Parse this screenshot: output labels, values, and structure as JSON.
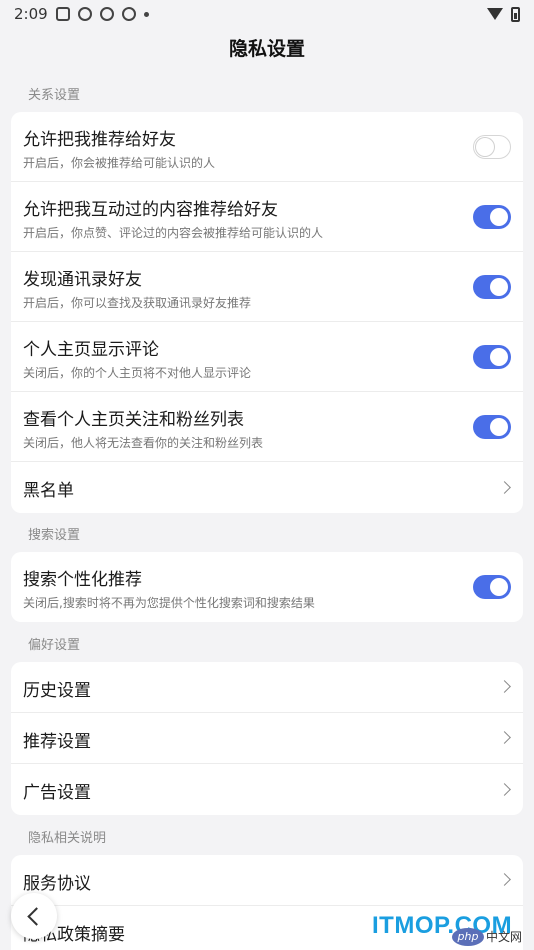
{
  "status_bar": {
    "time": "2:09"
  },
  "header": {
    "title": "隐私设置"
  },
  "sections": {
    "relations": {
      "label": "关系设置",
      "items": [
        {
          "title": "允许把我推荐给好友",
          "subtitle": "开启后，你会被推荐给可能认识的人",
          "toggle": "off"
        },
        {
          "title": "允许把我互动过的内容推荐给好友",
          "subtitle": "开启后，你点赞、评论过的内容会被推荐给可能认识的人",
          "toggle": "on"
        },
        {
          "title": "发现通讯录好友",
          "subtitle": "开启后，你可以查找及获取通讯录好友推荐",
          "toggle": "on"
        },
        {
          "title": "个人主页显示评论",
          "subtitle": "关闭后，你的个人主页将不对他人显示评论",
          "toggle": "on"
        },
        {
          "title": "查看个人主页关注和粉丝列表",
          "subtitle": "关闭后，他人将无法查看你的关注和粉丝列表",
          "toggle": "on"
        },
        {
          "title": "黑名单"
        }
      ]
    },
    "search": {
      "label": "搜索设置",
      "items": [
        {
          "title": "搜索个性化推荐",
          "subtitle": "关闭后,搜索时将不再为您提供个性化搜索词和搜索结果",
          "toggle": "on"
        }
      ]
    },
    "preferences": {
      "label": "偏好设置",
      "items": [
        {
          "title": "历史设置"
        },
        {
          "title": "推荐设置"
        },
        {
          "title": "广告设置"
        }
      ]
    },
    "privacy_info": {
      "label": "隐私相关说明",
      "items": [
        {
          "title": "服务协议"
        },
        {
          "title": "隐私政策摘要"
        }
      ]
    }
  },
  "watermark": {
    "text": "ITMOP.COM",
    "badge": "php",
    "suffix": "中文网"
  },
  "colors": {
    "accent": "#4a6ee8",
    "background": "#f3f3f5",
    "card": "#ffffff"
  }
}
